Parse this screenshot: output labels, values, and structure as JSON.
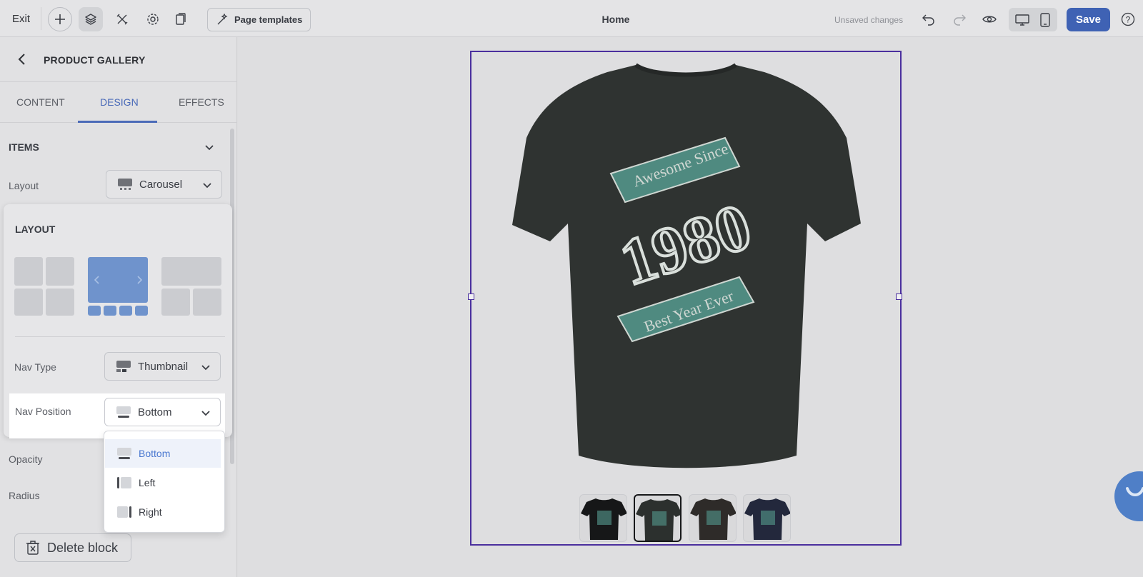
{
  "topbar": {
    "exit_label": "Exit",
    "templates_label": "Page templates",
    "page_title": "Home",
    "unsaved_label": "Unsaved changes",
    "save_label": "Save"
  },
  "panel": {
    "title": "PRODUCT GALLERY",
    "tabs": [
      {
        "label": "CONTENT"
      },
      {
        "label": "DESIGN",
        "active": true
      },
      {
        "label": "EFFECTS"
      }
    ],
    "items_section": "ITEMS",
    "layout_label": "Layout",
    "layout_value": "Carousel",
    "opacity_label": "Opacity",
    "radius_label": "Radius",
    "delete_label": "Delete block"
  },
  "layout_popover": {
    "title": "LAYOUT",
    "options": [
      "grid",
      "carousel",
      "hero-grid"
    ],
    "selected": "carousel",
    "nav_type_label": "Nav Type",
    "nav_type_value": "Thumbnail",
    "nav_position_label": "Nav Position",
    "nav_position_value": "Bottom",
    "nav_position_options": [
      {
        "label": "Bottom",
        "selected": true
      },
      {
        "label": "Left"
      },
      {
        "label": "Right"
      }
    ]
  },
  "gallery": {
    "thumbnails": [
      {
        "color": "#161718"
      },
      {
        "color": "#2c302e",
        "active": true
      },
      {
        "color": "#2e2b29"
      },
      {
        "color": "#23283c"
      }
    ]
  },
  "colors": {
    "accent": "#4a6ab8",
    "save_button": "#3f62b4",
    "selection": "#4a2f9e",
    "shirt": "#2f3331",
    "shirt_print": "#4f8a80"
  }
}
